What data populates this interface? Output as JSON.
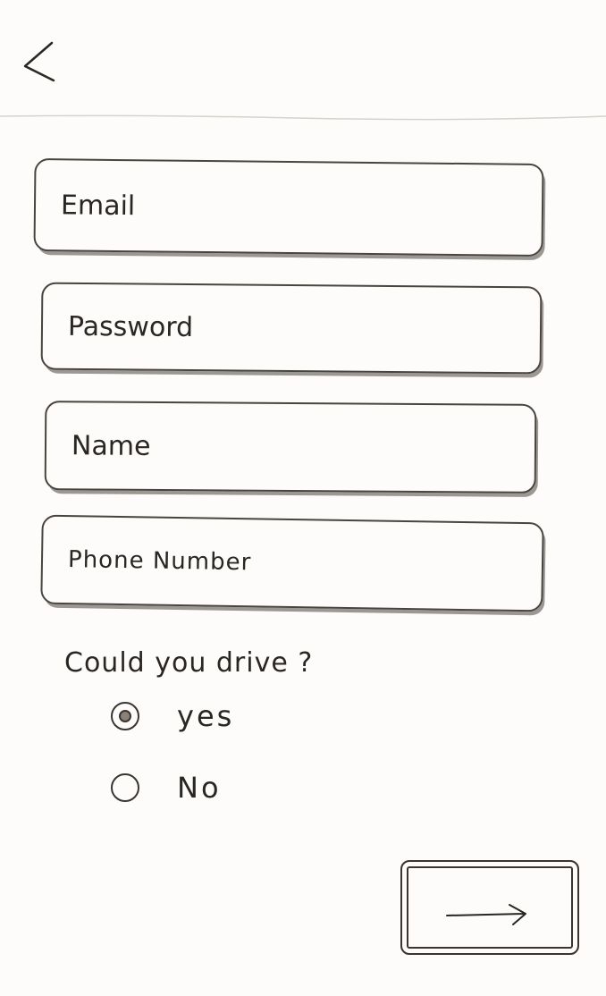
{
  "header": {
    "back_icon": "chevron-left-icon"
  },
  "form": {
    "email_placeholder": "Email",
    "password_placeholder": "Password",
    "name_placeholder": "Name",
    "phone_placeholder": "Phone Number",
    "question": "Could you drive ?",
    "options": [
      {
        "label": "yes",
        "selected": true
      },
      {
        "label": "No",
        "selected": false
      }
    ]
  },
  "footer": {
    "next_icon": "arrow-right-icon"
  },
  "colors": {
    "ink": "#2a2622",
    "paper": "#fdfcfa",
    "radio_fill": "#8a8178"
  }
}
